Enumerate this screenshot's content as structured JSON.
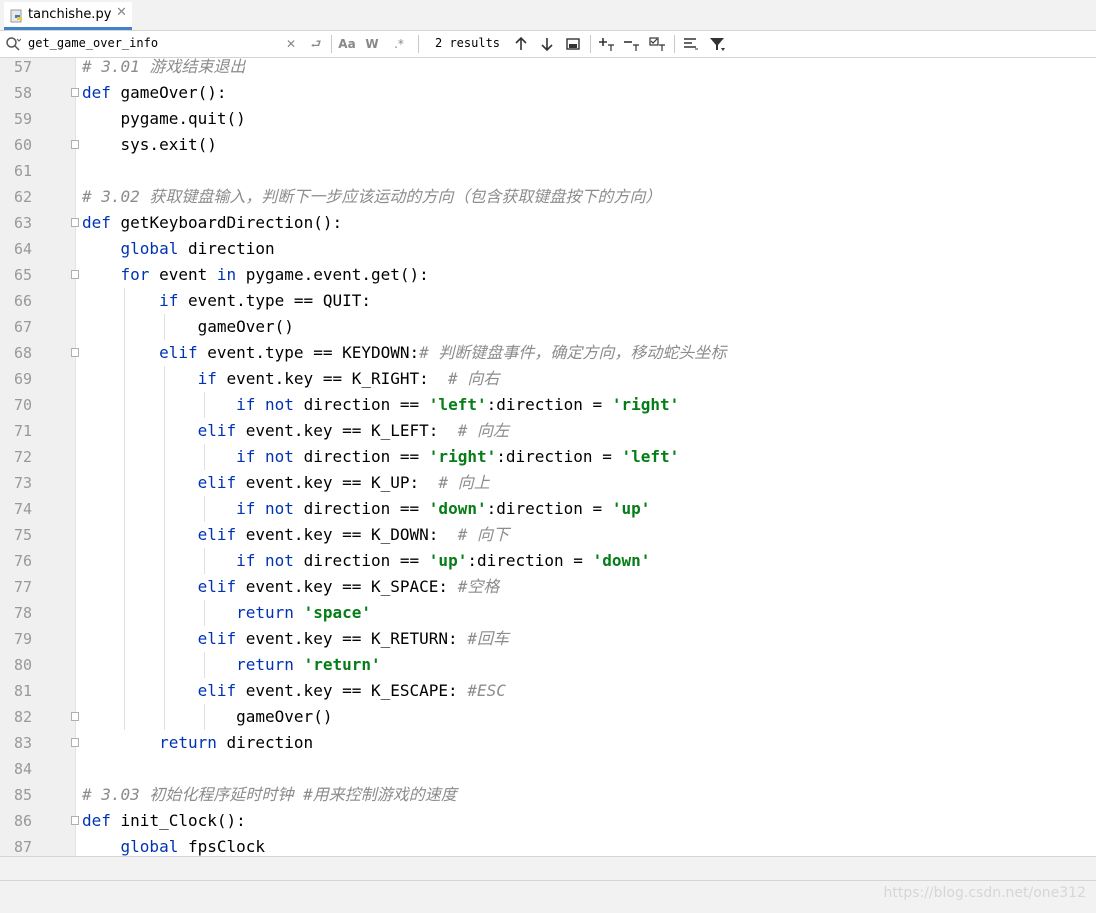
{
  "tab": {
    "label": "tanchishe.py",
    "close": "✕"
  },
  "search": {
    "query": "get_game_over_info",
    "results": "2 results"
  },
  "toolbar": {
    "match_case": "Aa",
    "words": "W",
    "regex": ".*"
  },
  "watermark": "https://blog.csdn.net/one312",
  "colors": {
    "keyword": "#0033b3",
    "string": "#067d17",
    "comment": "#8c8c8c",
    "tab_accent": "#4083c9"
  },
  "code_lines": [
    {
      "n": "57",
      "t": "# 3.01 游戏结束退出"
    },
    {
      "n": "58",
      "t": "def gameOver():"
    },
    {
      "n": "59",
      "t": "    pygame.quit()"
    },
    {
      "n": "60",
      "t": "    sys.exit()"
    },
    {
      "n": "61",
      "t": ""
    },
    {
      "n": "62",
      "t": "# 3.02 获取键盘输入，判断下一步应该运动的方向（包含获取键盘按下的方向）"
    },
    {
      "n": "63",
      "t": "def getKeyboardDirection():"
    },
    {
      "n": "64",
      "t": "    global direction"
    },
    {
      "n": "65",
      "t": "    for event in pygame.event.get():"
    },
    {
      "n": "66",
      "t": "        if event.type == QUIT:"
    },
    {
      "n": "67",
      "t": "            gameOver()"
    },
    {
      "n": "68",
      "t": "        elif event.type == KEYDOWN:# 判断键盘事件，确定方向，移动蛇头坐标"
    },
    {
      "n": "69",
      "t": "            if event.key == K_RIGHT:  # 向右"
    },
    {
      "n": "70",
      "t": "                if not direction == 'left':direction = 'right'"
    },
    {
      "n": "71",
      "t": "            elif event.key == K_LEFT:  # 向左"
    },
    {
      "n": "72",
      "t": "                if not direction == 'right':direction = 'left'"
    },
    {
      "n": "73",
      "t": "            elif event.key == K_UP:  # 向上"
    },
    {
      "n": "74",
      "t": "                if not direction == 'down':direction = 'up'"
    },
    {
      "n": "75",
      "t": "            elif event.key == K_DOWN:  # 向下"
    },
    {
      "n": "76",
      "t": "                if not direction == 'up':direction = 'down'"
    },
    {
      "n": "77",
      "t": "            elif event.key == K_SPACE: #空格"
    },
    {
      "n": "78",
      "t": "                return 'space'"
    },
    {
      "n": "79",
      "t": "            elif event.key == K_RETURN: #回车"
    },
    {
      "n": "80",
      "t": "                return 'return'"
    },
    {
      "n": "81",
      "t": "            elif event.key == K_ESCAPE: #ESC"
    },
    {
      "n": "82",
      "t": "                gameOver()"
    },
    {
      "n": "83",
      "t": "        return direction"
    },
    {
      "n": "84",
      "t": ""
    },
    {
      "n": "85",
      "t": "# 3.03 初始化程序延时时钟 #用来控制游戏的速度"
    },
    {
      "n": "86",
      "t": "def init_Clock():"
    },
    {
      "n": "87",
      "t": "    global fpsClock"
    }
  ]
}
